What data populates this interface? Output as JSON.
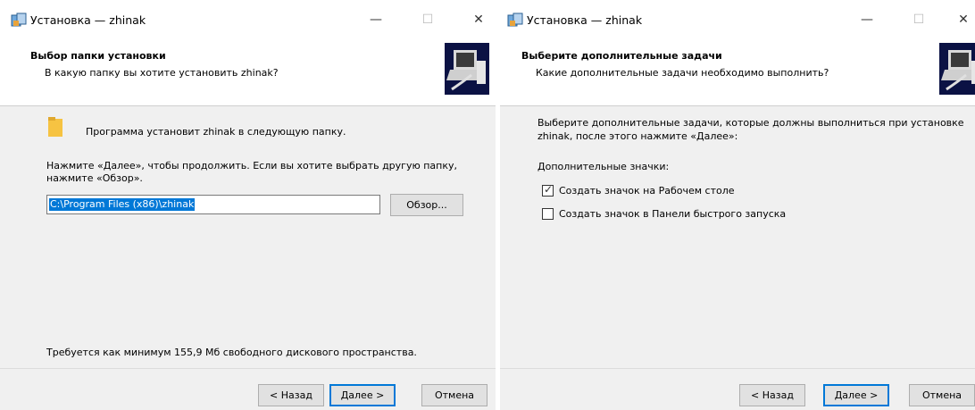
{
  "left": {
    "title": "Установка — zhinak",
    "header_title": "Выбор папки установки",
    "header_subtitle": "В какую папку вы хотите установить zhinak?",
    "folder_text": "Программа установит zhinak в следующую папку.",
    "instruction_line1": "Нажмите «Далее», чтобы продолжить. Если вы хотите выбрать другую папку,",
    "instruction_line2": "нажмите «Обзор».",
    "path_value": "C:\\Program Files (x86)\\zhinak",
    "browse_label": "Обзор...",
    "space_text": "Требуется как минимум 155,9 Мб свободного дискового пространства.",
    "back_label": "< Назад",
    "next_label": "Далее >",
    "cancel_label": "Отмена"
  },
  "right": {
    "title": "Установка — zhinak",
    "header_title": "Выберите дополнительные задачи",
    "header_subtitle": "Какие дополнительные задачи необходимо выполнить?",
    "intro_line1": "Выберите дополнительные задачи, которые должны выполниться при установке",
    "intro_line2": "zhinak, после этого нажмите «Далее»:",
    "group_label": "Дополнительные значки:",
    "tasks": [
      {
        "label": "Создать значок на Рабочем столе",
        "checked": true
      },
      {
        "label": "Создать значок в Панели быстрого запуска",
        "checked": false
      }
    ],
    "back_label": "< Назад",
    "next_label": "Далее >",
    "cancel_label": "Отмена"
  },
  "window_controls": {
    "minimize": "—",
    "maximize": "☐",
    "close": "✕"
  },
  "colors": {
    "accent": "#0078d7",
    "body_bg": "#f0f0f0",
    "wizard_image_bg": "#0b1244",
    "folder_icon": "#f6c342"
  }
}
